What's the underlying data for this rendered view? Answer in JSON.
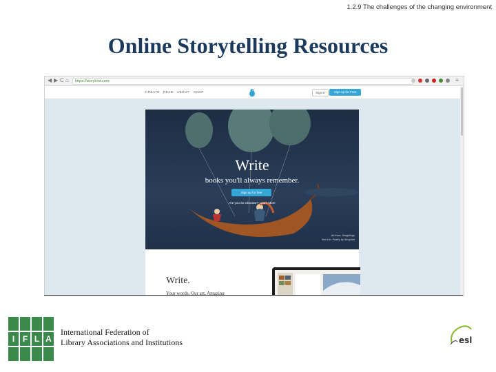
{
  "header_note": "1.2.9 The challenges of the changing environment",
  "slide_title": "Online Storytelling Resources",
  "browser": {
    "url": "https://storybird.com",
    "back": "◀",
    "forward": "▶",
    "reload": "C",
    "home": "⌂",
    "menu": "≡"
  },
  "site": {
    "nav": [
      "CREATE",
      "READ",
      "ABOUT",
      "SHOP"
    ],
    "sign_in": "Sign in",
    "sign_up": "Sign up for Free"
  },
  "hero": {
    "title": "Write",
    "subtitle": "books you'll always remember.",
    "button": "Sign up for free",
    "educator": "Are you an educator? Learn More",
    "credit_line1": "Art from: Seagirlings",
    "credit_line2": "See it in: Poetry by Storybird"
  },
  "below": {
    "heading": "Write.",
    "tagline": "Your words. Our art. Amazing"
  },
  "footer": {
    "ifla_letters": [
      "I",
      "F",
      "L",
      "A"
    ],
    "org_line1": "International Federation of",
    "org_line2": "Library Associations and Institutions",
    "esl_text": "esl"
  },
  "colors": {
    "title": "#1b3a5c",
    "ifla_green": "#3b8a4c",
    "signup_blue": "#36a6d6"
  }
}
